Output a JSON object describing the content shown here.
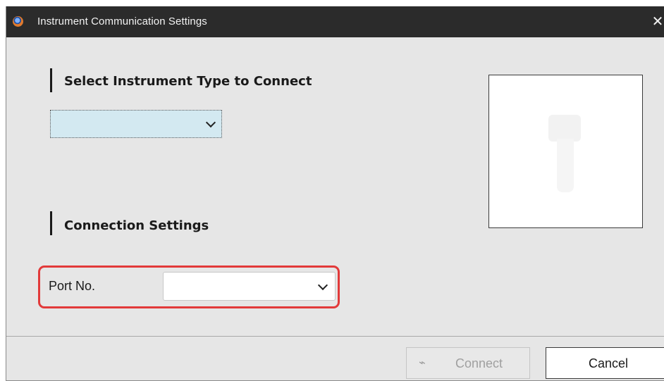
{
  "window": {
    "title": "Instrument Communication Settings",
    "close_glyph": "✕"
  },
  "instrument_section": {
    "title": "Select Instrument Type to Connect",
    "selected_value": ""
  },
  "connection_section": {
    "title": "Connection Settings",
    "port_label": "Port No.",
    "port_value": ""
  },
  "footer": {
    "connect_label": "Connect",
    "connect_icon_glyph": "⌁",
    "cancel_label": "Cancel"
  },
  "colors": {
    "titlebar": "#2b2b2b",
    "dialog_bg": "#e6e6e6",
    "select_highlight": "#d3e9f1",
    "annotation_red": "#e23a3a"
  }
}
